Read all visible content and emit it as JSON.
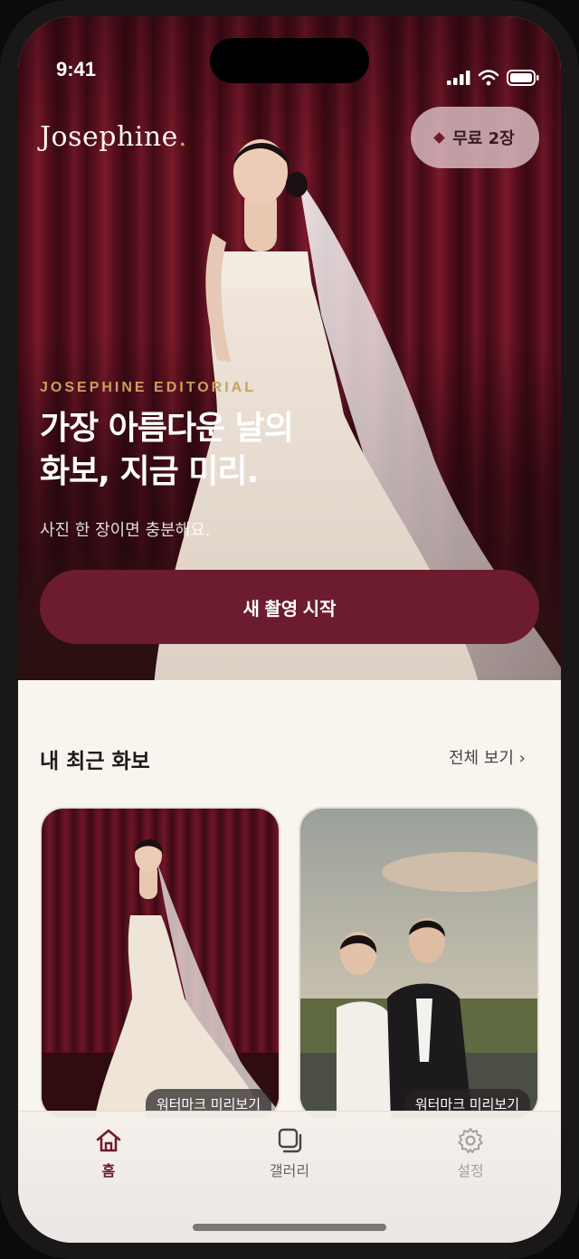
{
  "status": {
    "time": "9:41"
  },
  "brand": {
    "logo": "Josephine",
    "logo_dot": "."
  },
  "credits": {
    "label": "무료 2장"
  },
  "hero": {
    "eyebrow": "JOSEPHINE EDITORIAL",
    "headline_line1": "가장 아름다운 날의",
    "headline_line2": "화보, 지금 미리.",
    "subline": "사진 한 장이면 충분해요.",
    "cta_label": "새 촬영 시작"
  },
  "recent": {
    "title": "내 최근 화보",
    "see_all": "전체 보기 ›",
    "cards": [
      {
        "badge": "워터마크 미리보기"
      },
      {
        "badge": "워터마크 미리보기"
      }
    ]
  },
  "tabs": [
    {
      "label": "홈",
      "icon": "home-icon",
      "active": true
    },
    {
      "label": "갤러리",
      "icon": "gallery-icon",
      "active": false
    },
    {
      "label": "설정",
      "icon": "gear-icon",
      "active": false
    }
  ],
  "colors": {
    "accent": "#6c1c2e",
    "gold": "#c9a063",
    "background": "#f8f5ef"
  }
}
